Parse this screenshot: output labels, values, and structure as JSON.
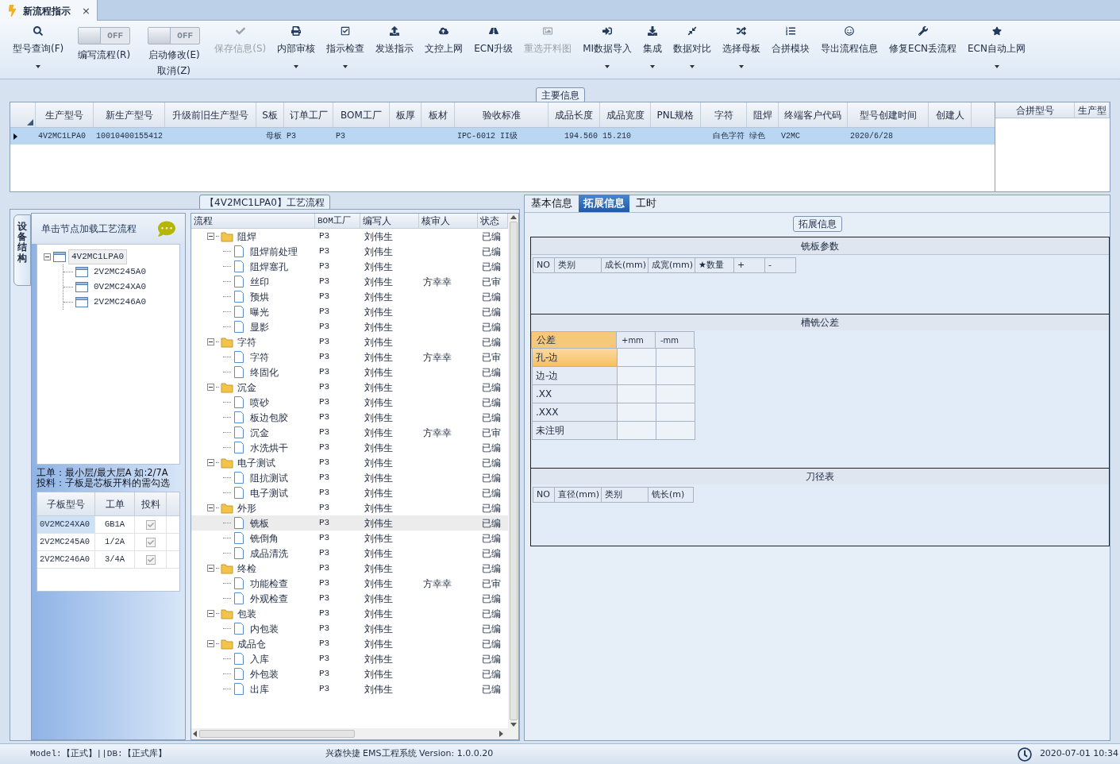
{
  "document_tab": {
    "label": "新流程指示",
    "close": "×",
    "selected": true
  },
  "toolbar": [
    {
      "kind": "button",
      "label": "型号查询(F)",
      "disabled": false,
      "dropdown": true
    },
    {
      "kind": "toggle",
      "switch_text": "OFF",
      "on": false,
      "label": "编写流程(R)"
    },
    {
      "kind": "toggle",
      "switch_text": "OFF",
      "on": false,
      "label": "启动修改(E)",
      "sublabel": "取消(Z)"
    },
    {
      "kind": "button",
      "label": "保存信息(S)",
      "disabled": true,
      "dropdown": false
    },
    {
      "kind": "button",
      "label": "内部审核",
      "disabled": false,
      "dropdown": true
    },
    {
      "kind": "button",
      "label": "指示检查",
      "disabled": false,
      "dropdown": true
    },
    {
      "kind": "button",
      "label": "发送指示",
      "disabled": false,
      "dropdown": false
    },
    {
      "kind": "button",
      "label": "文控上网",
      "disabled": false,
      "dropdown": false
    },
    {
      "kind": "button",
      "label": "ECN升级",
      "disabled": false,
      "dropdown": false
    },
    {
      "kind": "button",
      "label": "重选开料图",
      "disabled": true,
      "dropdown": false
    },
    {
      "kind": "button",
      "label": "MI数据导入",
      "disabled": false,
      "dropdown": true
    },
    {
      "kind": "button",
      "label": "集成",
      "disabled": false,
      "dropdown": true
    },
    {
      "kind": "button",
      "label": "数据对比",
      "disabled": false,
      "dropdown": true
    },
    {
      "kind": "button",
      "label": "选择母板",
      "disabled": false,
      "dropdown": true
    },
    {
      "kind": "button",
      "label": "合拼模块",
      "disabled": false,
      "dropdown": false
    },
    {
      "kind": "button",
      "label": "导出流程信息",
      "disabled": false,
      "dropdown": false
    },
    {
      "kind": "button",
      "label": "修复ECN丢流程",
      "disabled": false,
      "dropdown": false
    },
    {
      "kind": "button",
      "label": "ECN自动上网",
      "disabled": false,
      "dropdown": true
    }
  ],
  "main_info": {
    "title": "主要信息",
    "table": {
      "columns": [
        "生产型号",
        "新生产型号",
        "升级前旧生产型号",
        "S板",
        "订单工厂",
        "BOM工厂",
        "板厚",
        "板材",
        "验收标准",
        "成品长度",
        "成品宽度",
        "PNL规格",
        "字符",
        "阻焊",
        "终端客户代码",
        "型号创建时间",
        "创建人"
      ],
      "rows": [
        {
          "selected": true,
          "cells": [
            "4V2MC1LPA0",
            "10010400155412",
            null,
            "母板",
            "P3",
            "P3",
            null,
            null,
            "IPC-6012 II级",
            "194.560",
            "15.210",
            null,
            "白色字符",
            "绿色",
            "V2MC",
            "2020/6/28",
            null
          ]
        }
      ]
    },
    "side_table": {
      "columns": [
        "合拼型号",
        "生产型"
      ]
    }
  },
  "process_panel": {
    "title": "【4V2MC1LPA0】工艺流程",
    "side_tab": "设备结构",
    "tree_header": "单击节点加载工艺流程",
    "tree": [
      {
        "label": "4V2MC1LPA0",
        "selected": true,
        "expanded": true,
        "children": [
          {
            "label": "2V2MC245A0",
            "selected": false
          },
          {
            "label": "0V2MC24XA0",
            "selected": false
          },
          {
            "label": "2V2MC246A0",
            "selected": false
          }
        ]
      }
    ],
    "notes": [
      "工单：最小层/最大层A 如:2/7A",
      "投料：子板是芯板开料的需勾选"
    ],
    "sub_boards": {
      "columns": [
        "子板型号",
        "工单",
        "投料"
      ],
      "rows": [
        {
          "cells": [
            "0V2MC24XA0",
            "GB1A"
          ],
          "checked": true,
          "selected": true
        },
        {
          "cells": [
            "2V2MC245A0",
            "1/2A"
          ],
          "checked": true,
          "selected": false
        },
        {
          "cells": [
            "2V2MC246A0",
            "3/4A"
          ],
          "checked": true,
          "selected": false
        }
      ]
    },
    "flow": {
      "columns": [
        "流程",
        "BOM工厂",
        "编写人",
        "核审人",
        "状态"
      ],
      "groups": [
        {
          "name": "阻焊",
          "expanded": true,
          "bom": "P3",
          "author": "刘伟生",
          "status": "已编",
          "children": [
            {
              "name": "阻焊前处理",
              "bom": "P3",
              "author": "刘伟生",
              "status": "已编",
              "selected": false
            },
            {
              "name": "阻焊塞孔",
              "bom": "P3",
              "author": "刘伟生",
              "status": "已编",
              "selected": false
            },
            {
              "name": "丝印",
              "bom": "P3",
              "author": "刘伟生",
              "reviewer": "方幸幸",
              "status": "已审",
              "selected": false
            },
            {
              "name": "预烘",
              "bom": "P3",
              "author": "刘伟生",
              "status": "已编",
              "selected": false
            },
            {
              "name": "曝光",
              "bom": "P3",
              "author": "刘伟生",
              "status": "已编",
              "selected": false
            },
            {
              "name": "显影",
              "bom": "P3",
              "author": "刘伟生",
              "status": "已编",
              "selected": false
            }
          ]
        },
        {
          "name": "字符",
          "expanded": true,
          "bom": "P3",
          "author": "刘伟生",
          "status": "已编",
          "children": [
            {
              "name": "字符",
              "bom": "P3",
              "author": "刘伟生",
              "reviewer": "方幸幸",
              "status": "已审",
              "selected": false
            },
            {
              "name": "终固化",
              "bom": "P3",
              "author": "刘伟生",
              "status": "已编",
              "selected": false
            }
          ]
        },
        {
          "name": "沉金",
          "expanded": true,
          "bom": "P3",
          "author": "刘伟生",
          "status": "已编",
          "children": [
            {
              "name": "喷砂",
              "bom": "P3",
              "author": "刘伟生",
              "status": "已编",
              "selected": false
            },
            {
              "name": "板边包胶",
              "bom": "P3",
              "author": "刘伟生",
              "status": "已编",
              "selected": false
            },
            {
              "name": "沉金",
              "bom": "P3",
              "author": "刘伟生",
              "reviewer": "方幸幸",
              "status": "已审",
              "selected": false
            },
            {
              "name": "水洗烘干",
              "bom": "P3",
              "author": "刘伟生",
              "status": "已编",
              "selected": false
            }
          ]
        },
        {
          "name": "电子测试",
          "expanded": true,
          "bom": "P3",
          "author": "刘伟生",
          "status": "已编",
          "children": [
            {
              "name": "阻抗测试",
              "bom": "P3",
              "author": "刘伟生",
              "status": "已编",
              "selected": false
            },
            {
              "name": "电子测试",
              "bom": "P3",
              "author": "刘伟生",
              "status": "已编",
              "selected": false
            }
          ]
        },
        {
          "name": "外形",
          "expanded": true,
          "bom": "P3",
          "author": "刘伟生",
          "status": "已编",
          "children": [
            {
              "name": "铣板",
              "bom": "P3",
              "author": "刘伟生",
              "status": "已编",
              "selected": true
            },
            {
              "name": "铣倒角",
              "bom": "P3",
              "author": "刘伟生",
              "status": "已编",
              "selected": false
            },
            {
              "name": "成品清洗",
              "bom": "P3",
              "author": "刘伟生",
              "status": "已编",
              "selected": false
            }
          ]
        },
        {
          "name": "终检",
          "expanded": true,
          "bom": "P3",
          "author": "刘伟生",
          "status": "已编",
          "children": [
            {
              "name": "功能检查",
              "bom": "P3",
              "author": "刘伟生",
              "reviewer": "方幸幸",
              "status": "已审",
              "selected": false
            },
            {
              "name": "外观检查",
              "bom": "P3",
              "author": "刘伟生",
              "status": "已编",
              "selected": false
            }
          ]
        },
        {
          "name": "包装",
          "expanded": true,
          "bom": "P3",
          "author": "刘伟生",
          "status": "已编",
          "children": [
            {
              "name": "内包装",
              "bom": "P3",
              "author": "刘伟生",
              "status": "已编",
              "selected": false
            }
          ]
        },
        {
          "name": "成品仓",
          "expanded": true,
          "bom": "P3",
          "author": "刘伟生",
          "status": "已编",
          "children": [
            {
              "name": "入库",
              "bom": "P3",
              "author": "刘伟生",
              "status": "已编",
              "selected": false
            },
            {
              "name": "外包装",
              "bom": "P3",
              "author": "刘伟生",
              "status": "已编",
              "selected": false
            },
            {
              "name": "出库",
              "bom": "P3",
              "author": "刘伟生",
              "status": "已编",
              "selected": false
            }
          ]
        }
      ]
    }
  },
  "detail_panel": {
    "tabs": [
      {
        "label": "基本信息",
        "selected": false
      },
      {
        "label": "拓展信息",
        "selected": true
      },
      {
        "label": "工时",
        "selected": false
      }
    ],
    "group_title": "拓展信息",
    "milling": {
      "title": "铣板参数",
      "columns": [
        "NO",
        "类别",
        "成长(mm)",
        "成宽(mm)",
        "★数量",
        "+",
        "-"
      ]
    },
    "tolerance": {
      "title": "槽铣公差",
      "columns": [
        "公差",
        "+mm",
        "-mm"
      ],
      "rows": [
        {
          "label": "孔-边",
          "selected": true
        },
        {
          "label": "边-边",
          "selected": false
        },
        {
          "label": ".XX",
          "selected": false
        },
        {
          "label": ".XXX",
          "selected": false
        },
        {
          "label": "未注明",
          "selected": false
        }
      ]
    },
    "cutter": {
      "title": "刀径表",
      "columns": [
        "NO",
        "直径(mm)",
        "类别",
        "铣长(m)"
      ]
    }
  },
  "status_bar": {
    "mode": "Model:【正式】||DB:【正式库】",
    "system": "兴森快捷 EMS工程系统 Version: 1.0.0.20",
    "datetime": "2020-07-01 10:34"
  }
}
